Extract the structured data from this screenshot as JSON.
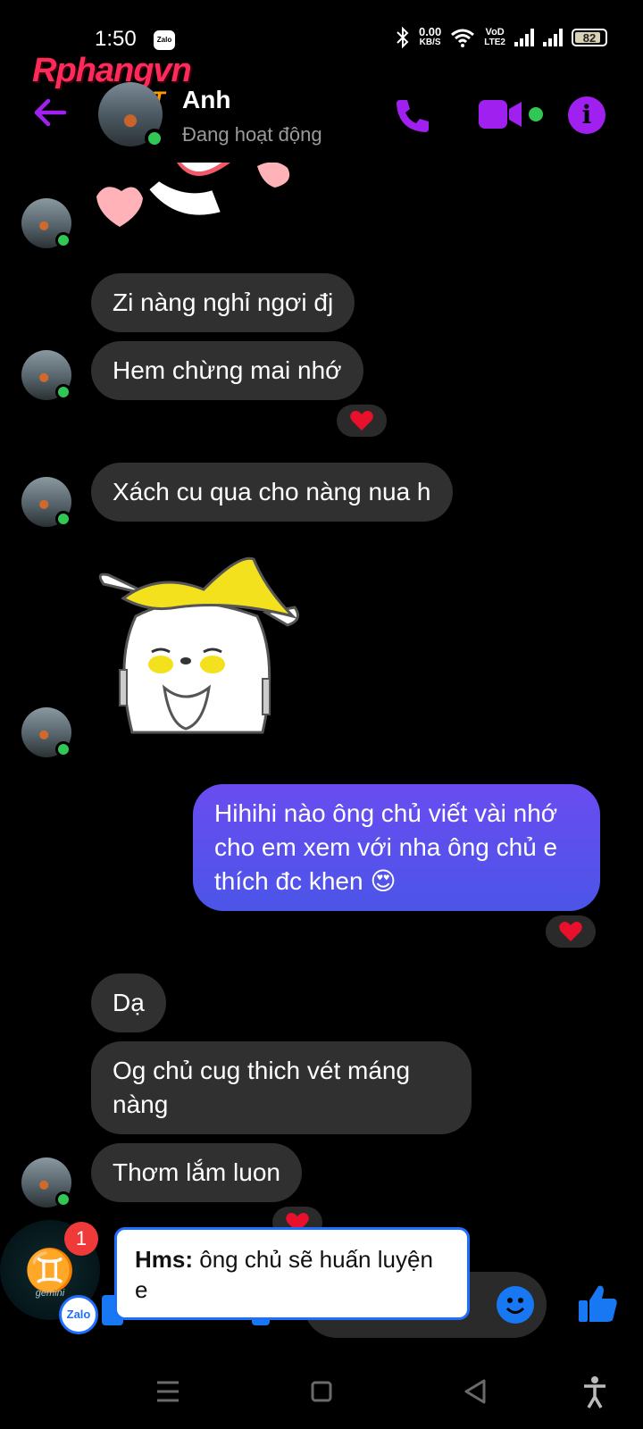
{
  "status_bar": {
    "time": "1:50",
    "zalo_icon_label": "Zalo",
    "net_speed_top": "0.00",
    "net_speed_unit": "KB/S",
    "volte_top": "VoD",
    "volte_bottom": "LTE2",
    "battery": "82"
  },
  "watermark": {
    "brand": "Rphangvn",
    "tld": ".NET"
  },
  "header": {
    "contact_name": "Anh",
    "contact_status": "Đang hoạt động",
    "icons": [
      "back-arrow-icon",
      "phone-icon",
      "video-camera-icon",
      "info-icon"
    ],
    "accent_color": "#a020f0",
    "online_color": "#31c754"
  },
  "messages": [
    {
      "from": "them",
      "text": "Zi nàng nghỉ ngơi đj"
    },
    {
      "from": "them",
      "text": "Hem chừng mai nhớ",
      "reaction": "heart"
    },
    {
      "from": "them",
      "text": "Xách cu qua cho nàng nua h"
    },
    {
      "from": "them",
      "type": "sticker",
      "sticker": "banana-hat-character"
    },
    {
      "from": "me",
      "text": "Hihihi nào ông chủ viết vài nhớ cho em xem với nha ông chủ e thích đc khen 😍",
      "reaction": "heart"
    },
    {
      "from": "them",
      "text": "Dạ"
    },
    {
      "from": "them",
      "text": "Og chủ cug thich vét máng nàng"
    },
    {
      "from": "them",
      "text": "Thơm lắm luon",
      "reaction": "heart"
    }
  ],
  "zalo_notification": {
    "avatar_glyph": "♊",
    "avatar_caption": "gemini",
    "badge_count": "1",
    "app_label": "Zalo",
    "sender": "Hms:",
    "text": "ông chủ sẽ huấn luyện e"
  },
  "colors": {
    "bubble_them": "#303030",
    "bubble_me": "#5b50ec",
    "heart": "#e8102a",
    "zalo_blue": "#1e6fff"
  }
}
